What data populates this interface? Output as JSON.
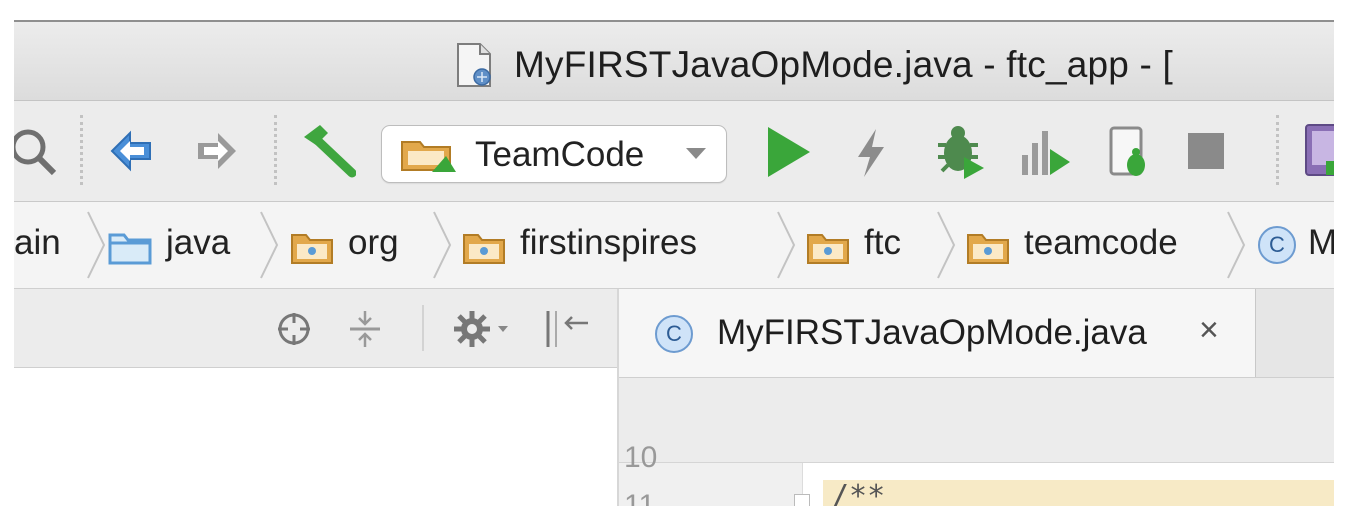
{
  "window": {
    "title": "MyFIRSTJavaOpMode.java - ftc_app - ["
  },
  "toolbar": {
    "run_config": "TeamCode",
    "icons": [
      "search-icon",
      "back-arrow-icon",
      "forward-arrow-icon",
      "hammer-build-icon",
      "folder-module-icon",
      "run-icon",
      "apply-changes-icon",
      "debug-icon",
      "profile-icon",
      "attach-debugger-icon",
      "stop-icon",
      "avd-manager-icon"
    ]
  },
  "breadcrumb": {
    "items": [
      {
        "label": "ain"
      },
      {
        "label": "java"
      },
      {
        "label": "org"
      },
      {
        "label": "firstinspires"
      },
      {
        "label": "ftc"
      },
      {
        "label": "teamcode"
      },
      {
        "label": "M"
      }
    ],
    "class_badge": "C"
  },
  "project_panel": {
    "icons": [
      "locate-icon",
      "collapse-icon",
      "gear-icon",
      "hide-panel-icon"
    ]
  },
  "editor": {
    "tab_label": "MyFIRSTJavaOpMode.java",
    "tab_close": "×",
    "tab_badge": "C",
    "gutter_lines": [
      "10",
      "11"
    ],
    "code_preview": "/**"
  },
  "colors": {
    "run_green": "#3aa63a",
    "folder_orange": "#e2a84b",
    "folder_blue": "#5a9bd6",
    "nav_blue": "#4a8fd8",
    "code_highlight": "#f7eac6"
  }
}
